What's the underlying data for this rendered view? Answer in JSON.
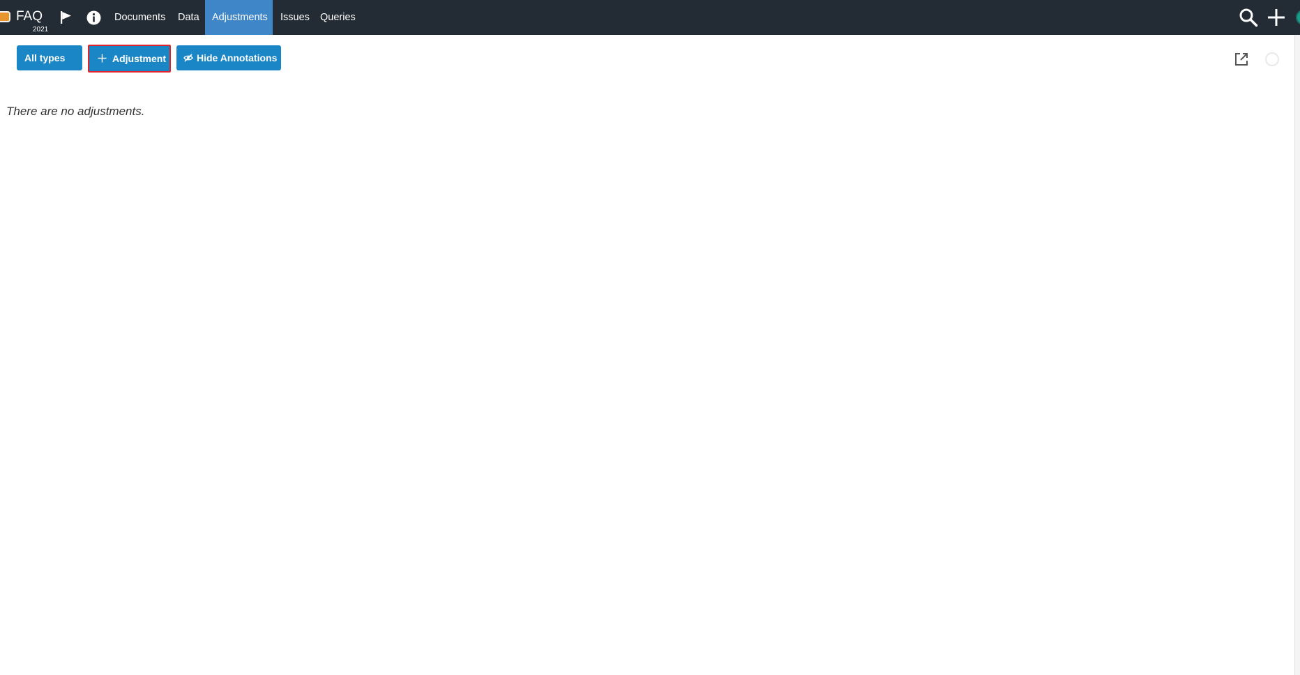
{
  "header": {
    "app_title": "FAQ",
    "app_year": "2021",
    "nav": [
      {
        "label": "Documents",
        "active": false
      },
      {
        "label": "Data",
        "active": false
      },
      {
        "label": "Adjustments",
        "active": true
      },
      {
        "label": "Issues",
        "active": false
      },
      {
        "label": "Queries",
        "active": false
      }
    ],
    "icons": [
      "flag-icon",
      "info-icon",
      "search-icon",
      "plus-icon",
      "avatar"
    ]
  },
  "toolbar": {
    "types_label": "All types",
    "add_label": "Adjustment",
    "hide_label": "Hide Annotations"
  },
  "content": {
    "empty_message": "There are no adjustments."
  },
  "colors": {
    "topbar": "#232b35",
    "nav_active": "#3f86c9",
    "button": "#1a86c6",
    "highlight_border": "#e0262a",
    "app_badge": "#e8952e"
  }
}
